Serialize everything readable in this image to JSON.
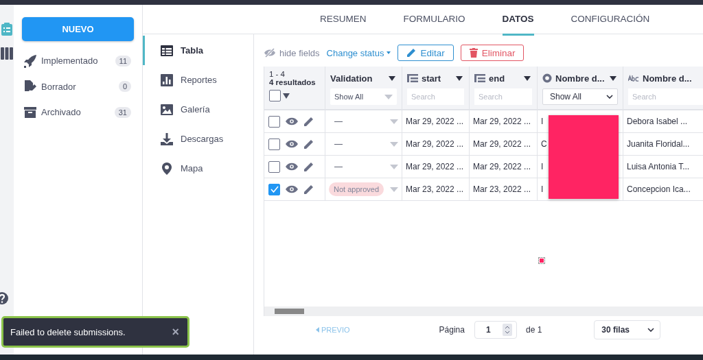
{
  "tabs": [
    {
      "label": "RESUMEN",
      "selected": false
    },
    {
      "label": "FORMULARIO",
      "selected": false
    },
    {
      "label": "DATOS",
      "selected": true
    },
    {
      "label": "CONFIGURACIÓN",
      "selected": false
    }
  ],
  "rail": [
    {
      "kind": "clipboard",
      "selected": true
    },
    {
      "kind": "library",
      "selected": false
    }
  ],
  "sidebar": {
    "new_button": "NUEVO",
    "items": [
      {
        "kind": "rocket",
        "label": "Implementado",
        "count": "11"
      },
      {
        "kind": "draft",
        "label": "Borrador",
        "count": "0"
      },
      {
        "kind": "archive",
        "label": "Archivado",
        "count": "31"
      }
    ]
  },
  "views": [
    {
      "kind": "table",
      "label": "Tabla",
      "selected": true
    },
    {
      "kind": "chart",
      "label": "Reportes",
      "selected": false
    },
    {
      "kind": "image",
      "label": "Galería",
      "selected": false
    },
    {
      "kind": "download",
      "label": "Descargas",
      "selected": false
    },
    {
      "kind": "pin",
      "label": "Mapa",
      "selected": false
    }
  ],
  "toolbar": {
    "hide_fields": "hide fields",
    "change_status": "Change status",
    "edit": "Editar",
    "delete": "Eliminar"
  },
  "table": {
    "range": "1 - 4",
    "results": "4 resultados",
    "select_all": false,
    "columns": [
      {
        "kind": "plain",
        "label": "Validation",
        "filter": {
          "kind": "muted-select",
          "value": "Show All"
        }
      },
      {
        "kind": "date",
        "label": "start",
        "filter": {
          "kind": "search",
          "placeholder": "Search"
        }
      },
      {
        "kind": "date",
        "label": "end",
        "filter": {
          "kind": "search",
          "placeholder": "Search"
        }
      },
      {
        "kind": "choice",
        "label": "Nombre d...",
        "filter": {
          "kind": "select",
          "value": "Show All"
        }
      },
      {
        "kind": "text",
        "label": "Nombre d...",
        "filter": {
          "kind": "search",
          "placeholder": "Search"
        }
      }
    ],
    "rows": [
      {
        "checked": false,
        "validation": {
          "kind": "dash",
          "text": "—"
        },
        "start": "Mar 29, 2022 ...",
        "end": "Mar 29, 2022 ...",
        "column_5": "I",
        "column_6": "Debora Isabel ..."
      },
      {
        "checked": false,
        "validation": {
          "kind": "dash",
          "text": "—"
        },
        "start": "Mar 29, 2022 ...",
        "end": "Mar 29, 2022 ...",
        "column_5": "C",
        "column_6": "Juanita Floridal..."
      },
      {
        "checked": false,
        "validation": {
          "kind": "dash",
          "text": "—"
        },
        "start": "Mar 29, 2022 ...",
        "end": "Mar 29, 2022 ...",
        "column_5": "I",
        "column_6": "Luisa Antonia T..."
      },
      {
        "checked": true,
        "validation": {
          "kind": "badge",
          "text": "Not approved"
        },
        "start": "Mar 23, 2022 ...",
        "end": "Mar 23, 2022 ...",
        "column_5": "I",
        "column_6": "Concepcion Ica..."
      }
    ]
  },
  "pagination": {
    "previous": "PREVIO",
    "page_label": "Página",
    "page": "1",
    "of": "de 1",
    "rows": "30 filas"
  },
  "toast": {
    "message": "Failed to delete submissions.",
    "close": "×"
  }
}
